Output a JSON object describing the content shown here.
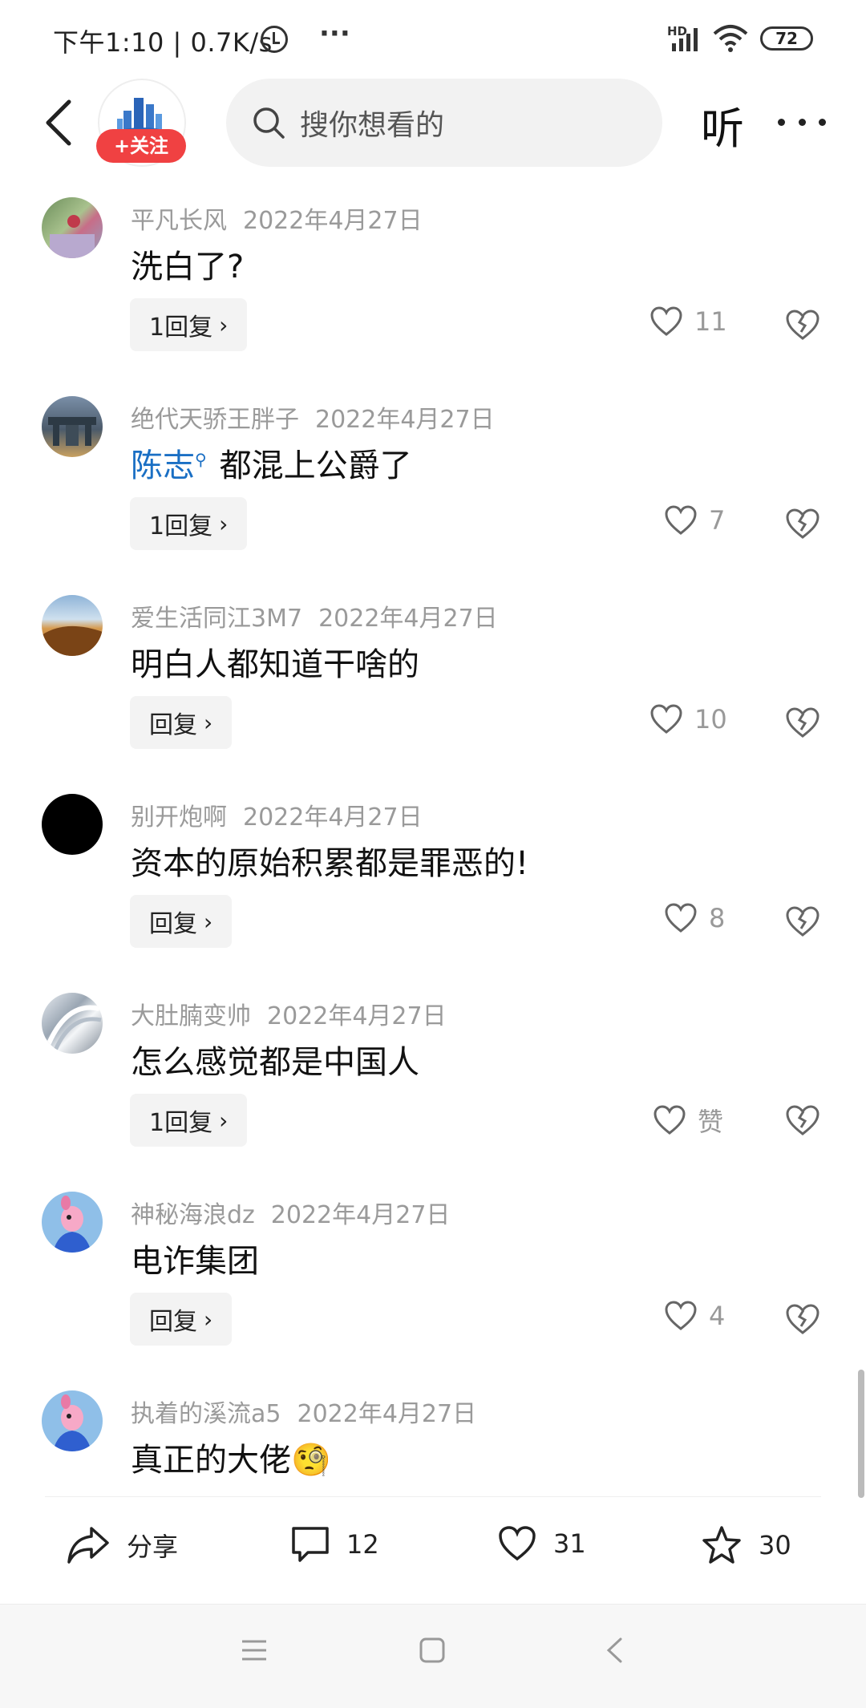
{
  "status_bar": {
    "time_text": "下午1:10 | 0.7K/s",
    "hd_label": "HD",
    "battery": "72"
  },
  "header": {
    "follow_label": "+关注",
    "search_placeholder": "搜你想看的",
    "listen_label": "听"
  },
  "comments": [
    {
      "user": "平凡长风",
      "date": "2022年4月27日",
      "text": "洗白了?",
      "reply": "1回复",
      "likes": "11"
    },
    {
      "user": "绝代天骄王胖子",
      "date": "2022年4月27日",
      "mention": "陈志",
      "text": "都混上公爵了",
      "reply": "1回复",
      "likes": "7"
    },
    {
      "user": "爱生活同江3M7",
      "date": "2022年4月27日",
      "text": "明白人都知道干啥的",
      "reply": "回复",
      "likes": "10"
    },
    {
      "user": "别开炮啊",
      "date": "2022年4月27日",
      "text": "资本的原始积累都是罪恶的!",
      "reply": "回复",
      "likes": "8"
    },
    {
      "user": "大肚腩变帅",
      "date": "2022年4月27日",
      "text": "怎么感觉都是中国人",
      "reply": "1回复",
      "likes": "赞"
    },
    {
      "user": "神秘海浪dz",
      "date": "2022年4月27日",
      "text": "电诈集团",
      "reply": "回复",
      "likes": "4"
    },
    {
      "user": "执着的溪流a5",
      "date": "2022年4月27日",
      "text": "真正的大佬🧐"
    }
  ],
  "action_bar": {
    "share_label": "分享",
    "comment_count": "12",
    "like_count": "31",
    "favorite_count": "30"
  },
  "colors": {
    "accent_red": "#f04142",
    "mention_blue": "#1a6fc4",
    "meta_gray": "#9a9a9a"
  }
}
